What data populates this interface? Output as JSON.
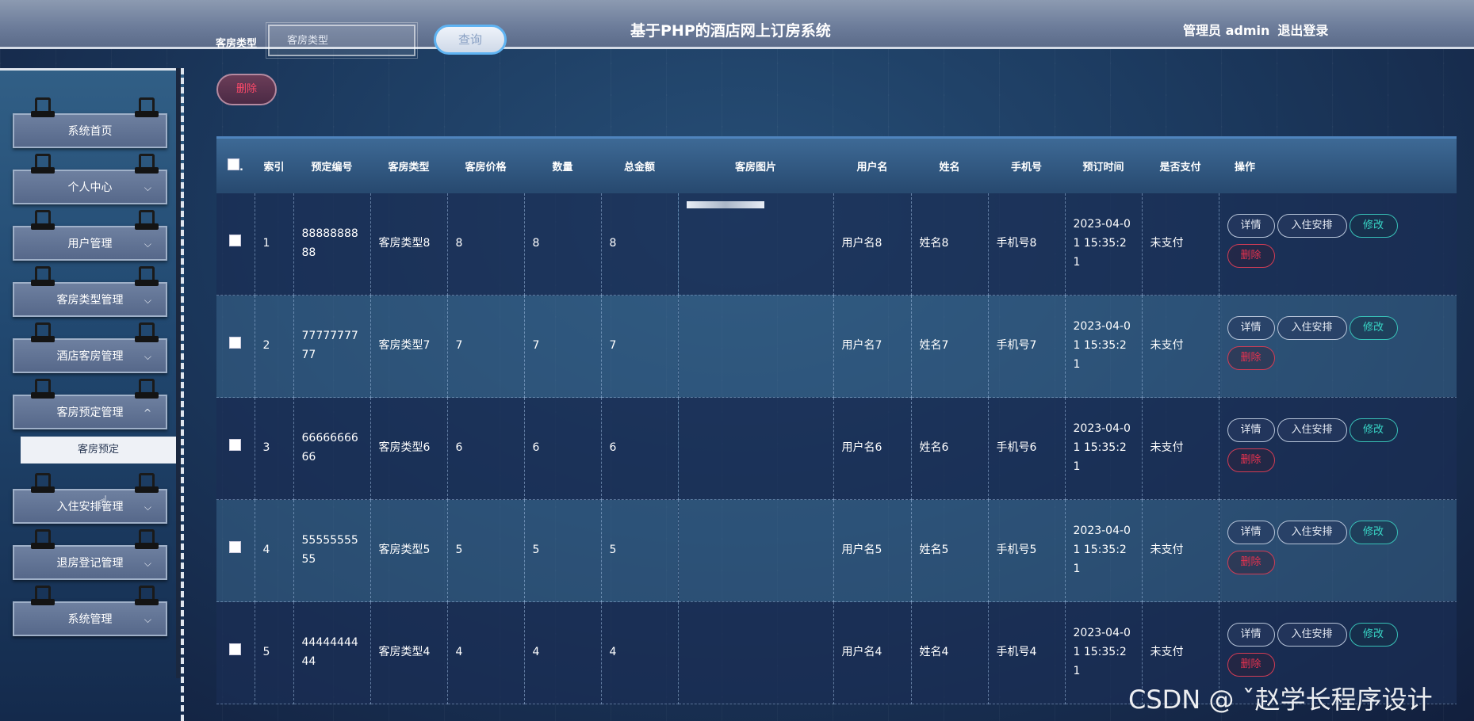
{
  "header": {
    "search_label": "客房类型",
    "search_placeholder": "客房类型",
    "search_button": "查询",
    "app_title": "基于PHP的酒店网上订房系统",
    "admin_text": "管理员 admin",
    "logout": "退出登录"
  },
  "sidebar": {
    "items": [
      {
        "label": "系统首页",
        "has_chevron": false
      },
      {
        "label": "个人中心",
        "has_chevron": true
      },
      {
        "label": "用户管理",
        "has_chevron": true
      },
      {
        "label": "客房类型管理",
        "has_chevron": true
      },
      {
        "label": "酒店客房管理",
        "has_chevron": true
      },
      {
        "label": "客房预定管理",
        "has_chevron": true
      },
      {
        "label": "入住安排管理",
        "has_chevron": true
      },
      {
        "label": "退房登记管理",
        "has_chevron": true
      },
      {
        "label": "系统管理",
        "has_chevron": true
      }
    ],
    "submenu": "客房预定",
    "chevron_down": "⌵",
    "chevron_up": "^"
  },
  "toolbar": {
    "delete_label": "删除"
  },
  "table": {
    "columns": [
      "索引",
      "预定编号",
      "客房类型",
      "客房价格",
      "数量",
      "总金额",
      "客房图片",
      "用户名",
      "姓名",
      "手机号",
      "预订时间",
      "是否支付",
      "操作"
    ],
    "rows": [
      {
        "index": "1",
        "booking_no": "8888888888",
        "room_type": "客房类型8",
        "price": "8",
        "quantity": "8",
        "total": "8",
        "username": "用户名8",
        "name": "姓名8",
        "phone": "手机号8",
        "time": "2023-04-01 15:35:21",
        "paid": "未支付"
      },
      {
        "index": "2",
        "booking_no": "7777777777",
        "room_type": "客房类型7",
        "price": "7",
        "quantity": "7",
        "total": "7",
        "username": "用户名7",
        "name": "姓名7",
        "phone": "手机号7",
        "time": "2023-04-01 15:35:21",
        "paid": "未支付"
      },
      {
        "index": "3",
        "booking_no": "6666666666",
        "room_type": "客房类型6",
        "price": "6",
        "quantity": "6",
        "total": "6",
        "username": "用户名6",
        "name": "姓名6",
        "phone": "手机号6",
        "time": "2023-04-01 15:35:21",
        "paid": "未支付"
      },
      {
        "index": "4",
        "booking_no": "5555555555",
        "room_type": "客房类型5",
        "price": "5",
        "quantity": "5",
        "total": "5",
        "username": "用户名5",
        "name": "姓名5",
        "phone": "手机号5",
        "time": "2023-04-01 15:35:21",
        "paid": "未支付"
      },
      {
        "index": "5",
        "booking_no": "4444444444",
        "room_type": "客房类型4",
        "price": "4",
        "quantity": "4",
        "total": "4",
        "username": "用户名4",
        "name": "姓名4",
        "phone": "手机号4",
        "time": "2023-04-01 15:35:21",
        "paid": "未支付"
      }
    ],
    "actions": {
      "detail": "详情",
      "checkin": "入住安排",
      "edit": "修改",
      "delete": "删除"
    }
  },
  "watermark": "CSDN @ ˇ赵学长程序设计"
}
